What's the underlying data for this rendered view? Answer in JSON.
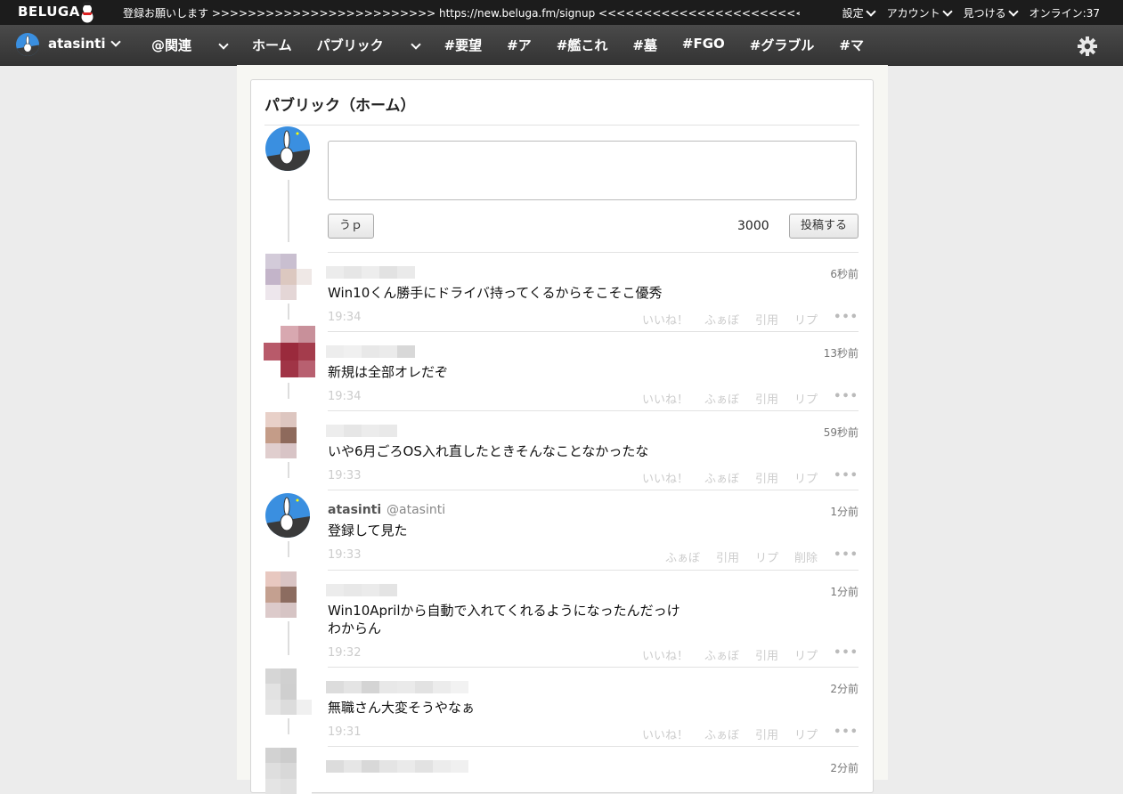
{
  "topbar": {
    "brand": "BELUGA",
    "marquee": "登録お願いします >>>>>>>>>>>>>>>>>>>>>>>>> https://new.beluga.fm/signup <<<<<<<<<<<<<<<<<<<<<<<<< 登録お願",
    "menu": [
      "設定",
      "アカウント",
      "見つける"
    ],
    "online": "オンライン:37"
  },
  "navbar": {
    "username": "atasinti",
    "items": [
      "@関連",
      "ホーム",
      "パブリック",
      "#要望",
      "#ア",
      "#艦これ",
      "#墓",
      "#FGO",
      "#グラブル",
      "#マ"
    ]
  },
  "panel": {
    "title": "パブリック（ホーム）",
    "compose": {
      "upload_label": "うｐ",
      "counter": "3000",
      "post_label": "投稿する"
    }
  },
  "actions": {
    "like": "いいね！",
    "fav": "ふぁぼ",
    "quote": "引用",
    "reply": "リプ",
    "delete": "削除",
    "more": "•••"
  },
  "posts": [
    {
      "name": "",
      "handle": "",
      "ago": "6秒前",
      "text": "Win10くん勝手にドライバ持ってくるからそこそこ優秀",
      "time": "19:34"
    },
    {
      "name": "",
      "handle": "",
      "ago": "13秒前",
      "text": "新規は全部オレだぞ",
      "time": "19:34"
    },
    {
      "name": "",
      "handle": "",
      "ago": "59秒前",
      "text": "いや6月ごろOS入れ直したときそんなことなかったな",
      "time": "19:33"
    },
    {
      "name": "atasinti",
      "handle": "@atasinti",
      "ago": "1分前",
      "text": "登録して見た",
      "time": "19:33"
    },
    {
      "name": "",
      "handle": "",
      "ago": "1分前",
      "text": "Win10Aprilから自動で入れてくれるようになったんだっけ\nわからん",
      "time": "19:32"
    },
    {
      "name": "",
      "handle": "",
      "ago": "2分前",
      "text": "無職さん大変そうやなぁ",
      "time": "19:31"
    },
    {
      "name": "",
      "handle": "",
      "ago": "2分前",
      "text": "",
      "time": ""
    }
  ],
  "colors": {
    "topbar_bg": "#1c1c1c",
    "navbar_bg": "#3c3c3c",
    "action_text": "#cccccc",
    "avatar_blue": "#3a8fe0"
  }
}
